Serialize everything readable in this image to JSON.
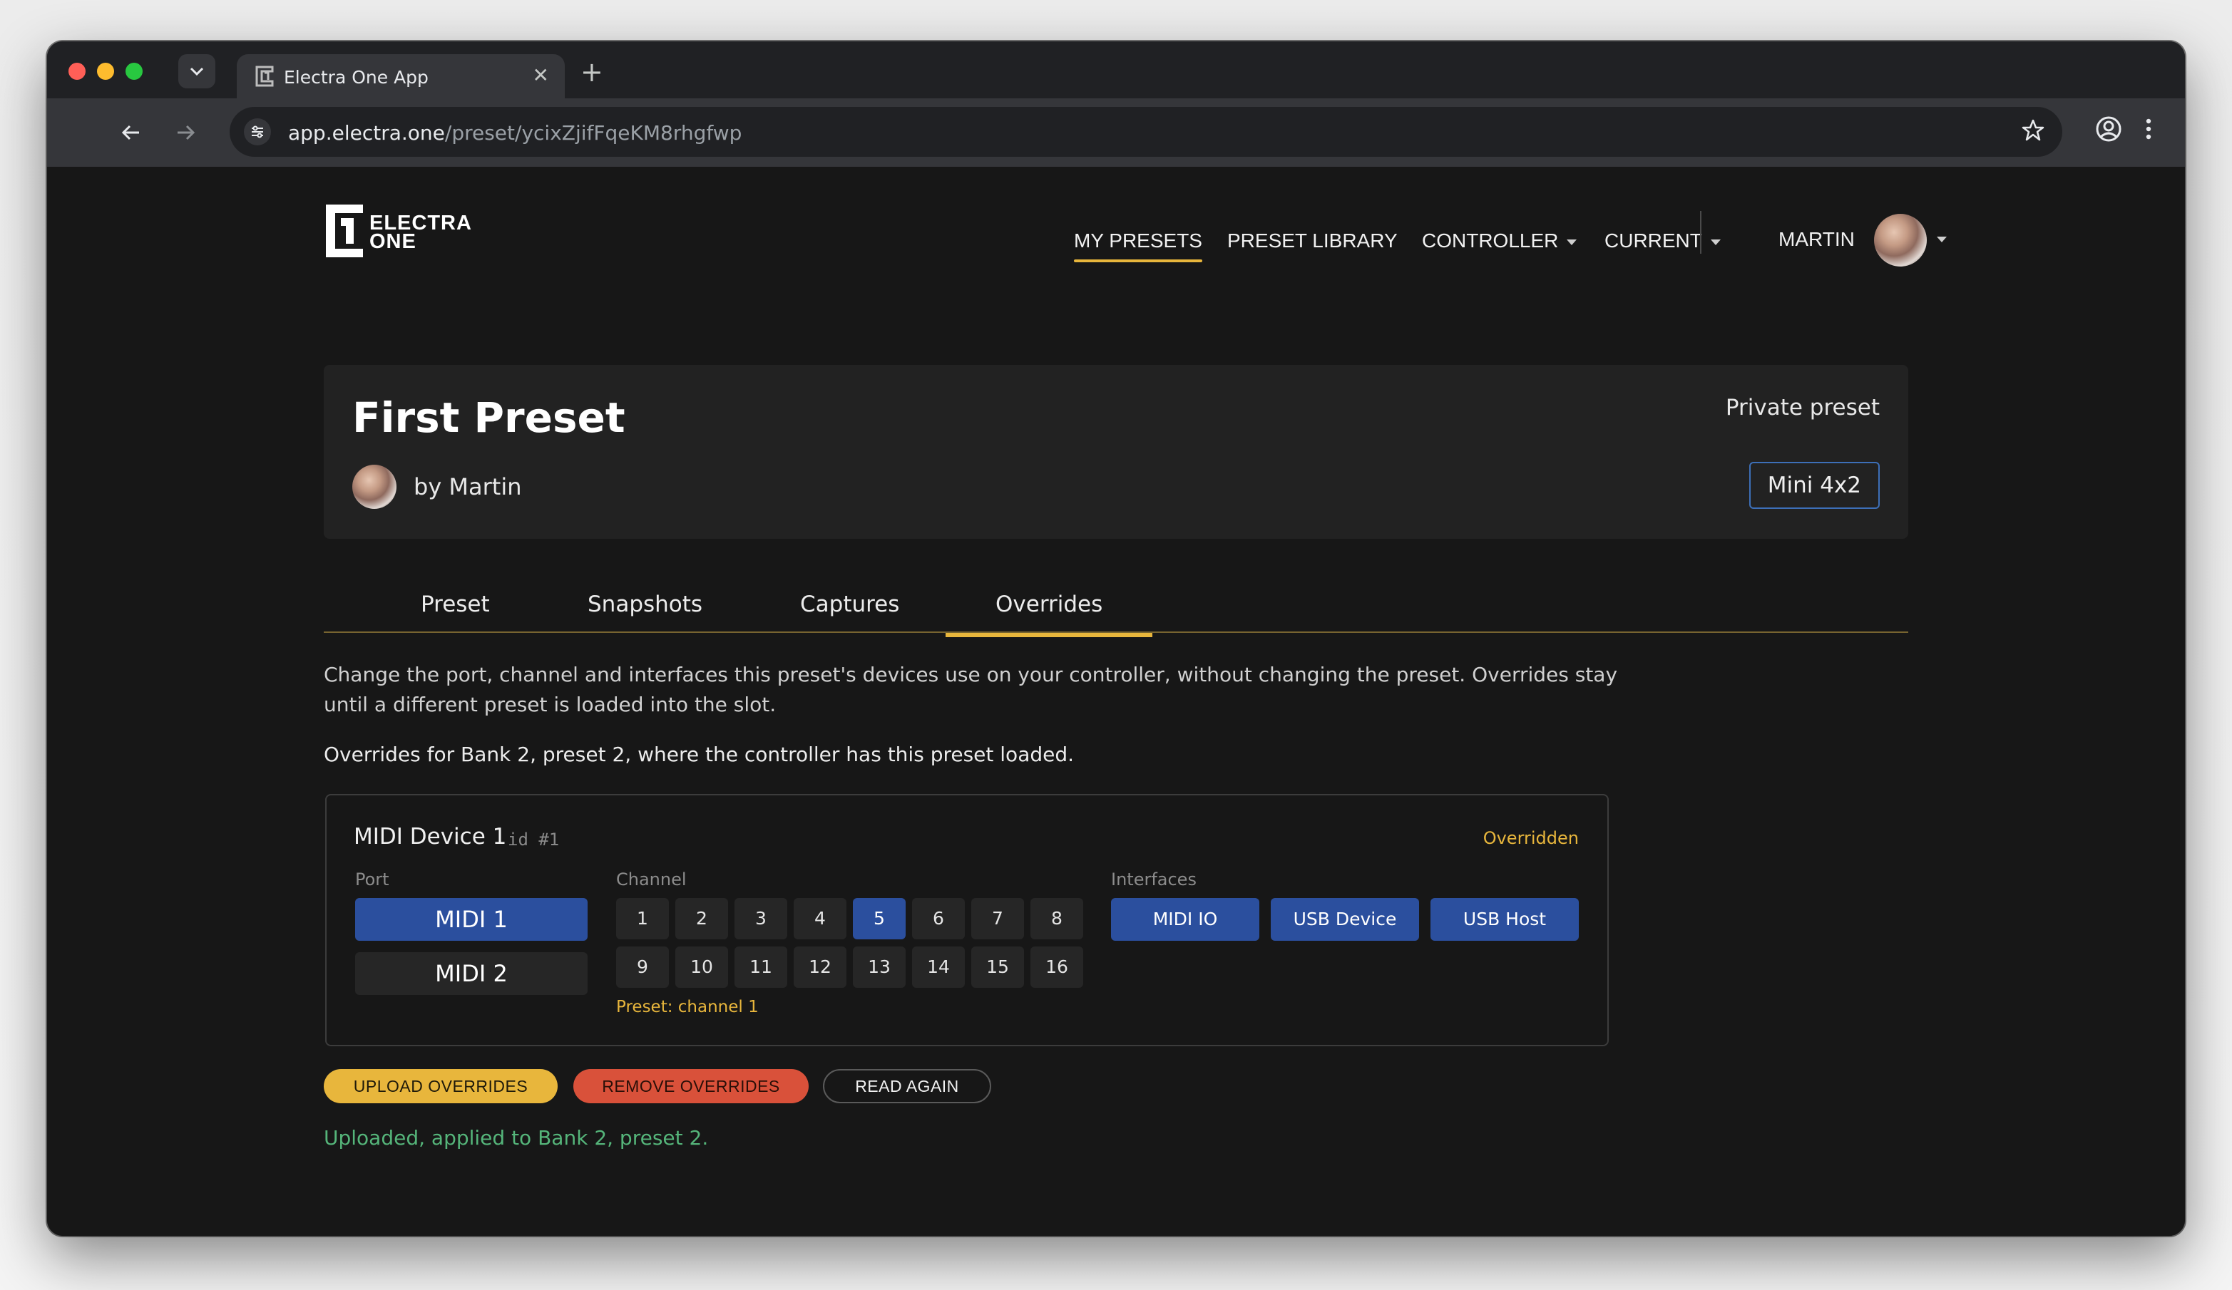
{
  "browser": {
    "tab_title": "Electra One App",
    "url_host": "app.electra.one",
    "url_path": "/preset/ycixZjifFqeKM8rhgfwp"
  },
  "logo": {
    "line1": "ELECTRA",
    "line2": "ONE"
  },
  "nav": {
    "my_presets": "MY PRESETS",
    "preset_library": "PRESET LIBRARY",
    "controller": "CONTROLLER",
    "current": "CURRENT",
    "user": "MARTIN"
  },
  "preset": {
    "title": "First Preset",
    "author": "by Martin",
    "visibility": "Private preset",
    "device_model": "Mini 4x2"
  },
  "tabs": [
    {
      "label": "Preset",
      "active": false
    },
    {
      "label": "Snapshots",
      "active": false
    },
    {
      "label": "Captures",
      "active": false
    },
    {
      "label": "Overrides",
      "active": true
    }
  ],
  "overrides": {
    "description": "Change the port, channel and interfaces this preset's devices use on your controller, without changing the preset. Overrides stay until a different preset is loaded into the slot.",
    "slot_info": "Overrides for Bank 2, preset 2, where the controller has this preset loaded.",
    "device": {
      "name": "MIDI Device 1",
      "id": "id #1",
      "status": "Overridden",
      "port_label": "Port",
      "ports": [
        "MIDI 1",
        "MIDI 2"
      ],
      "selected_port": "MIDI 1",
      "channel_label": "Channel",
      "channels": [
        "1",
        "2",
        "3",
        "4",
        "5",
        "6",
        "7",
        "8",
        "9",
        "10",
        "11",
        "12",
        "13",
        "14",
        "15",
        "16"
      ],
      "selected_channel": "5",
      "preset_channel_note": "Preset: channel 1",
      "interfaces_label": "Interfaces",
      "interfaces": [
        "MIDI IO",
        "USB Device",
        "USB Host"
      ]
    },
    "buttons": {
      "upload": "UPLOAD OVERRIDES",
      "remove": "REMOVE OVERRIDES",
      "read_again": "READ AGAIN"
    },
    "status_message": "Uploaded, applied to Bank 2, preset 2."
  },
  "colors": {
    "accent_yellow": "#e8b63c",
    "selected_blue": "#2b4f9e",
    "remove_red": "#d9513a",
    "success_green": "#55b57a"
  }
}
